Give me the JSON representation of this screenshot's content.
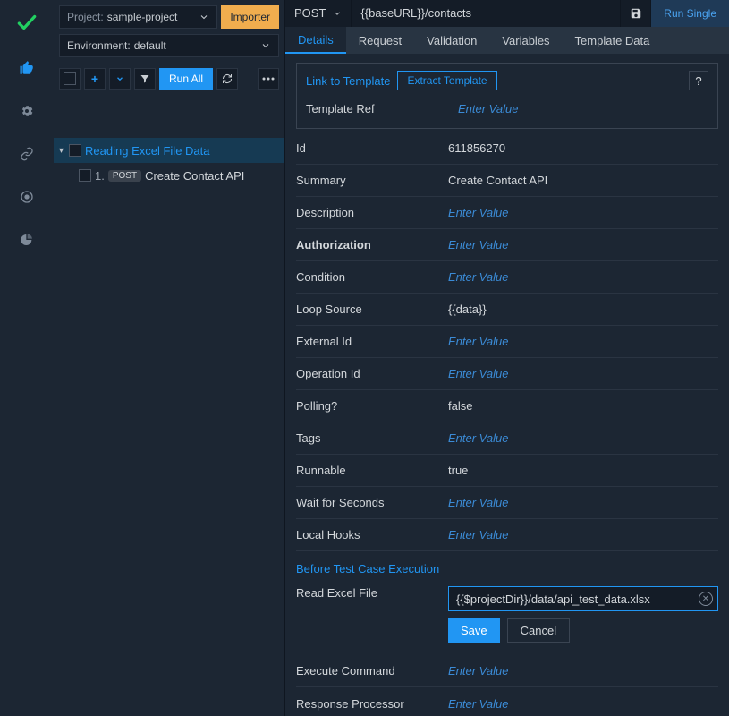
{
  "project": {
    "label": "Project:",
    "value": "sample-project"
  },
  "importer": "Importer",
  "environment": {
    "label": "Environment:",
    "value": "default"
  },
  "toolbar": {
    "runAll": "Run All"
  },
  "tree": {
    "folder": "Reading Excel File Data",
    "leaf": {
      "num": "1.",
      "method": "POST",
      "name": "Create Contact API"
    }
  },
  "request": {
    "method": "POST",
    "url": "{{baseURL}}/contacts",
    "runSingle": "Run Single"
  },
  "tabs": [
    "Details",
    "Request",
    "Validation",
    "Variables",
    "Template Data"
  ],
  "linkBox": {
    "title": "Link to Template",
    "extract": "Extract Template",
    "help": "?",
    "templateRefLabel": "Template Ref",
    "templateRefValue": "Enter Value"
  },
  "fields": [
    {
      "name": "Id",
      "value": "611856270",
      "placeholder": false
    },
    {
      "name": "Summary",
      "value": "Create Contact API",
      "placeholder": false
    },
    {
      "name": "Description",
      "value": "Enter Value",
      "placeholder": true
    },
    {
      "name": "Authorization",
      "value": "Enter Value",
      "placeholder": true,
      "bold": true
    },
    {
      "name": "Condition",
      "value": "Enter Value",
      "placeholder": true
    },
    {
      "name": "Loop Source",
      "value": "{{data}}",
      "placeholder": false
    },
    {
      "name": "External Id",
      "value": "Enter Value",
      "placeholder": true
    },
    {
      "name": "Operation Id",
      "value": "Enter Value",
      "placeholder": true
    },
    {
      "name": "Polling?",
      "value": "false",
      "placeholder": false
    },
    {
      "name": "Tags",
      "value": "Enter Value",
      "placeholder": true
    },
    {
      "name": "Runnable",
      "value": "true",
      "placeholder": false
    },
    {
      "name": "Wait for Seconds",
      "value": "Enter Value",
      "placeholder": true
    },
    {
      "name": "Local Hooks",
      "value": "Enter Value",
      "placeholder": true
    }
  ],
  "beforeExec": {
    "title": "Before Test Case Execution",
    "readExcelLabel": "Read Excel File",
    "readExcelValue": "{{$projectDir}}/data/api_test_data.xlsx",
    "save": "Save",
    "cancel": "Cancel",
    "executeCommand": {
      "name": "Execute Command",
      "value": "Enter Value"
    },
    "responseProcessor": {
      "name": "Response Processor",
      "value": "Enter Value"
    }
  }
}
